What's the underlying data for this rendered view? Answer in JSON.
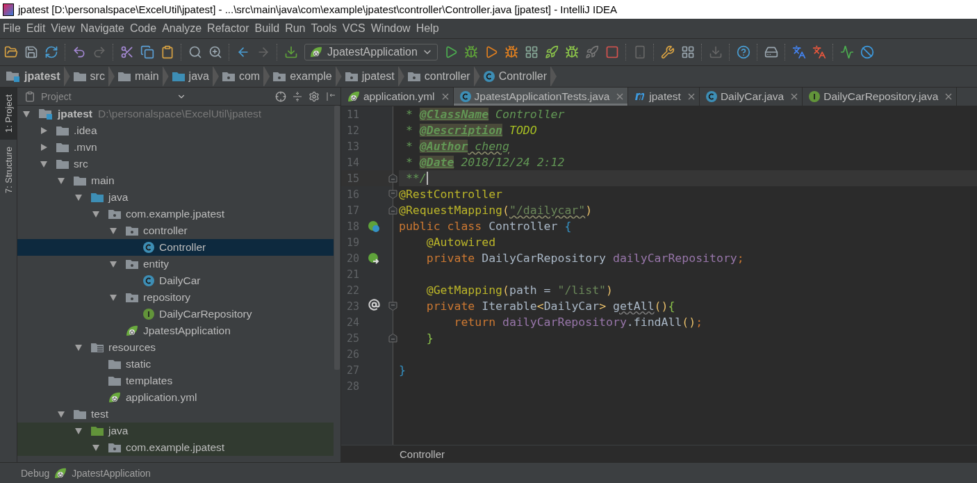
{
  "window": {
    "title": "jpatest [D:\\personalspace\\ExcelUtil\\jpatest] - ...\\src\\main\\java\\com\\example\\jpatest\\controller\\Controller.java [jpatest] - IntelliJ IDEA"
  },
  "menu": [
    "File",
    "Edit",
    "View",
    "Navigate",
    "Code",
    "Analyze",
    "Refactor",
    "Build",
    "Run",
    "Tools",
    "VCS",
    "Window",
    "Help"
  ],
  "toolbar": {
    "run_config": "JpatestApplication"
  },
  "breadcrumbs": [
    {
      "label": "jpatest",
      "kind": "module"
    },
    {
      "label": "src",
      "kind": "folder"
    },
    {
      "label": "main",
      "kind": "folder"
    },
    {
      "label": "java",
      "kind": "source"
    },
    {
      "label": "com",
      "kind": "package"
    },
    {
      "label": "example",
      "kind": "package"
    },
    {
      "label": "jpatest",
      "kind": "package"
    },
    {
      "label": "controller",
      "kind": "package"
    },
    {
      "label": "Controller",
      "kind": "class"
    }
  ],
  "tool_windows": [
    {
      "label": "1: Project",
      "selected": true
    },
    {
      "label": "7: Structure",
      "selected": false
    }
  ],
  "project_panel": {
    "title": "Project",
    "tree": [
      {
        "label": "jpatest",
        "path": "D:\\personalspace\\ExcelUtil\\jpatest",
        "kind": "module",
        "expanded": true,
        "selected": false,
        "children": [
          {
            "label": ".idea",
            "kind": "folder",
            "expanded": false,
            "selected": false
          },
          {
            "label": ".mvn",
            "kind": "folder",
            "expanded": false,
            "selected": false
          },
          {
            "label": "src",
            "kind": "folder",
            "expanded": true,
            "selected": false,
            "children": [
              {
                "label": "main",
                "kind": "folder",
                "expanded": true,
                "selected": false,
                "children": [
                  {
                    "label": "java",
                    "kind": "source",
                    "expanded": true,
                    "selected": false,
                    "children": [
                      {
                        "label": "com.example.jpatest",
                        "kind": "package",
                        "expanded": true,
                        "selected": false,
                        "children": [
                          {
                            "label": "controller",
                            "kind": "package",
                            "expanded": true,
                            "selected": false,
                            "children": [
                              {
                                "label": "Controller",
                                "kind": "class",
                                "selected": true
                              }
                            ]
                          },
                          {
                            "label": "entity",
                            "kind": "package",
                            "expanded": true,
                            "selected": false,
                            "children": [
                              {
                                "label": "DailyCar",
                                "kind": "class",
                                "selected": false
                              }
                            ]
                          },
                          {
                            "label": "repository",
                            "kind": "package",
                            "expanded": true,
                            "selected": false,
                            "children": [
                              {
                                "label": "DailyCarRepository",
                                "kind": "interface",
                                "selected": false
                              }
                            ]
                          },
                          {
                            "label": "JpatestApplication",
                            "kind": "springclass",
                            "selected": false
                          }
                        ]
                      }
                    ]
                  },
                  {
                    "label": "resources",
                    "kind": "resources",
                    "expanded": true,
                    "selected": false,
                    "children": [
                      {
                        "label": "static",
                        "kind": "folder",
                        "selected": false
                      },
                      {
                        "label": "templates",
                        "kind": "folder",
                        "selected": false
                      },
                      {
                        "label": "application.yml",
                        "kind": "spring",
                        "selected": false
                      }
                    ]
                  }
                ]
              },
              {
                "label": "test",
                "kind": "folder",
                "expanded": true,
                "selected": false,
                "children": [
                  {
                    "label": "java",
                    "kind": "testsource",
                    "expanded": true,
                    "selected": false,
                    "children": [
                      {
                        "label": "com.example.jpatest",
                        "kind": "package",
                        "expanded": true,
                        "selected": false
                      }
                    ]
                  }
                ]
              }
            ]
          }
        ]
      }
    ]
  },
  "editor": {
    "tabs": [
      {
        "label": "application.yml",
        "kind": "spring",
        "selected": false
      },
      {
        "label": "JpatestApplicationTests.java",
        "kind": "class",
        "selected": true
      },
      {
        "label": "jpatest",
        "kind": "maven",
        "selected": false
      },
      {
        "label": "DailyCar.java",
        "kind": "class",
        "selected": false
      },
      {
        "label": "DailyCarRepository.java",
        "kind": "interface",
        "selected": false
      }
    ],
    "lines": [
      {
        "number": "11",
        "current": false,
        "tokens": [
          {
            "kind": "doc",
            "text": " * "
          },
          {
            "kind": "doctag",
            "text": "@ClassName"
          },
          {
            "kind": "doc",
            "text": " Controller"
          }
        ]
      },
      {
        "number": "12",
        "current": false,
        "tokens": [
          {
            "kind": "doc",
            "text": " * "
          },
          {
            "kind": "doctag",
            "text": "@Description"
          },
          {
            "kind": "todo",
            "text": " TODO"
          }
        ]
      },
      {
        "number": "13",
        "current": false,
        "tokens": [
          {
            "kind": "doc",
            "text": " * "
          },
          {
            "kind": "doctag",
            "text": "@Author"
          },
          {
            "kind": "docwavy",
            "text": " cheng"
          }
        ]
      },
      {
        "number": "14",
        "current": false,
        "tokens": [
          {
            "kind": "doc",
            "text": " * "
          },
          {
            "kind": "doctag",
            "text": "@Date"
          },
          {
            "kind": "doc",
            "text": " 2018/12/24 2:12"
          }
        ]
      },
      {
        "number": "15",
        "current": true,
        "fold": {
          "kind": "end"
        },
        "tokens": [
          {
            "kind": "doc",
            "text": " **/"
          }
        ]
      },
      {
        "number": "16",
        "current": false,
        "fold": {
          "kind": "start"
        },
        "tokens": [
          {
            "kind": "annotation",
            "text": "@RestController"
          }
        ]
      },
      {
        "number": "17",
        "current": false,
        "fold": {
          "kind": "end"
        },
        "tokens": [
          {
            "kind": "annotation",
            "text": "@RequestMapping"
          },
          {
            "kind": "paren",
            "text": "("
          },
          {
            "kind": "stringwavy",
            "text": "\"/dailycar\""
          },
          {
            "kind": "paren",
            "text": ")"
          }
        ]
      },
      {
        "number": "18",
        "current": false,
        "gutter": {
          "kind": "bean"
        },
        "tokens": [
          {
            "kind": "keyword",
            "text": "public class "
          },
          {
            "kind": "text",
            "text": "Controller "
          },
          {
            "kind": "brace",
            "text": "{"
          }
        ]
      },
      {
        "number": "19",
        "current": false,
        "tokens": [
          {
            "kind": "annotation",
            "text": "    @Autowired"
          }
        ]
      },
      {
        "number": "20",
        "current": false,
        "gutter": {
          "kind": "autowired"
        },
        "tokens": [
          {
            "kind": "keyword",
            "text": "    private "
          },
          {
            "kind": "text",
            "text": "DailyCarRepository "
          },
          {
            "kind": "field",
            "text": "dailyCarRepository"
          },
          {
            "kind": "keyword",
            "text": ";"
          }
        ]
      },
      {
        "number": "21",
        "current": false
      },
      {
        "number": "22",
        "current": false,
        "tokens": [
          {
            "kind": "annotation",
            "text": "    @GetMapping"
          },
          {
            "kind": "paren",
            "text": "("
          },
          {
            "kind": "text",
            "text": "path = "
          },
          {
            "kind": "string",
            "text": "\"/list\""
          },
          {
            "kind": "paren",
            "text": ")"
          }
        ]
      },
      {
        "number": "23",
        "current": false,
        "gutter": {
          "kind": "mapping"
        },
        "fold": {
          "kind": "start"
        },
        "tokens": [
          {
            "kind": "keyword",
            "text": "    private "
          },
          {
            "kind": "text",
            "text": "Iterable"
          },
          {
            "kind": "paren",
            "text": "<"
          },
          {
            "kind": "text",
            "text": "DailyCar"
          },
          {
            "kind": "paren",
            "text": "> "
          },
          {
            "kind": "unused",
            "text": "getAll"
          },
          {
            "kind": "paren",
            "text": "()"
          },
          {
            "kind": "greenbrace",
            "text": "{"
          }
        ]
      },
      {
        "number": "24",
        "current": false,
        "tokens": [
          {
            "kind": "keyword",
            "text": "        return "
          },
          {
            "kind": "field",
            "text": "dailyCarRepository"
          },
          {
            "kind": "text",
            "text": ".findAll"
          },
          {
            "kind": "paren",
            "text": "()"
          },
          {
            "kind": "keyword",
            "text": ";"
          }
        ]
      },
      {
        "number": "25",
        "current": false,
        "fold": {
          "kind": "end"
        },
        "tokens": [
          {
            "kind": "greenbrace",
            "text": "    }"
          }
        ]
      },
      {
        "number": "26",
        "current": false
      },
      {
        "number": "27",
        "current": false,
        "tokens": [
          {
            "kind": "brace",
            "text": "}"
          }
        ]
      },
      {
        "number": "28",
        "current": false
      }
    ],
    "breadcrumb": "Controller"
  },
  "status_bar": {
    "label": "Debug",
    "app": "JpatestApplication"
  }
}
